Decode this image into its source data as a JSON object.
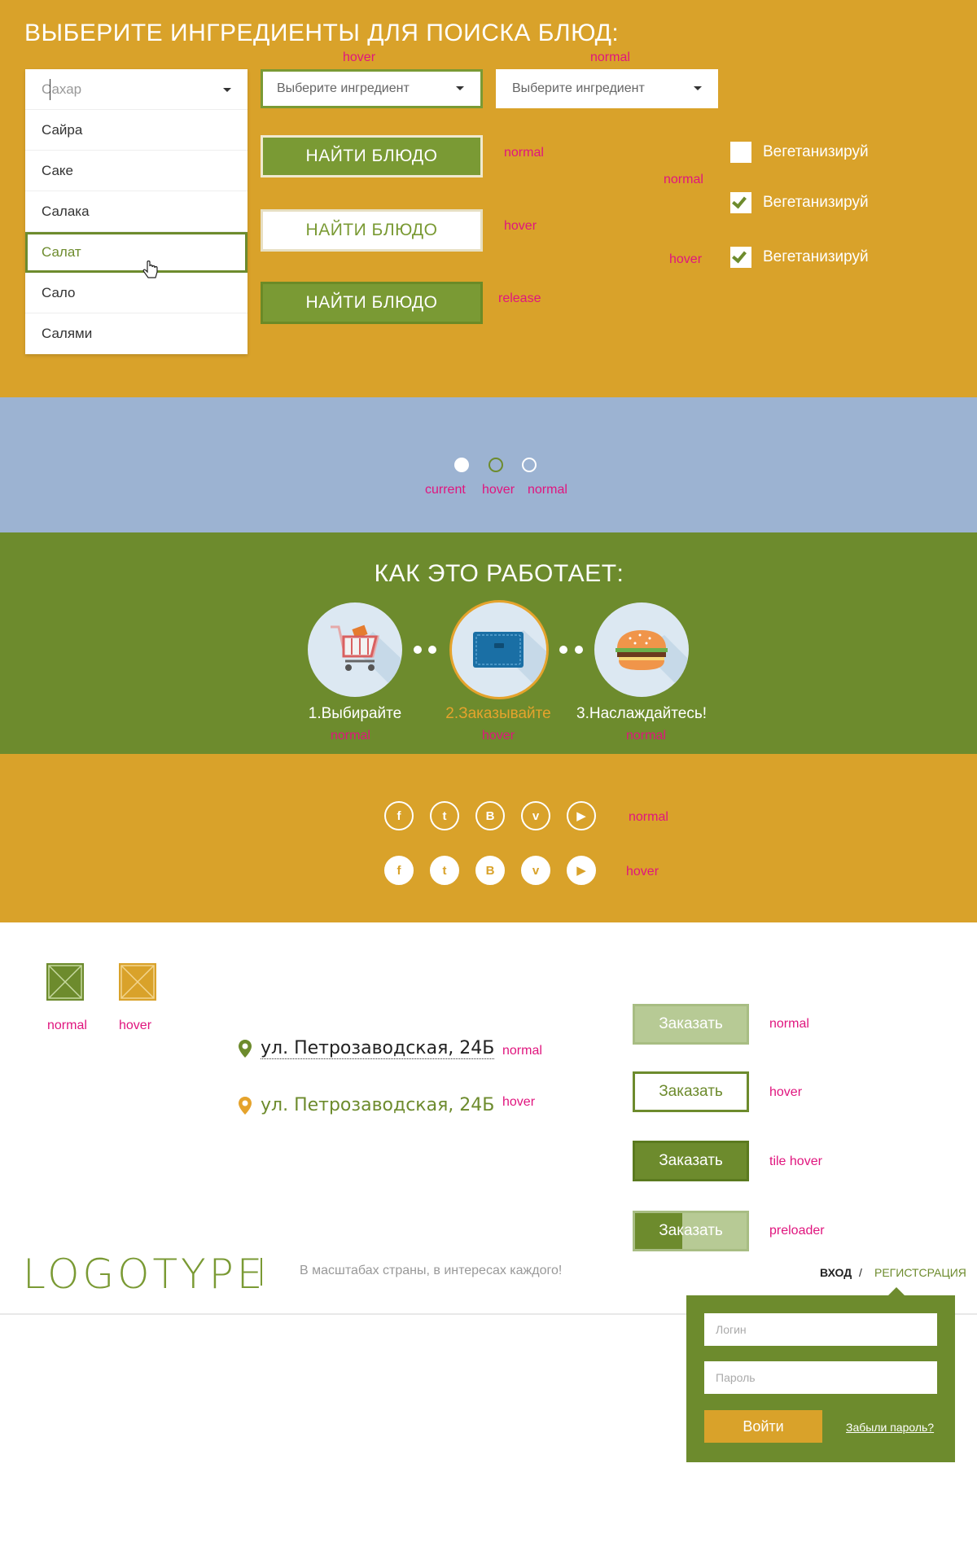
{
  "ingredients": {
    "heading": "ВЫБЕРИТЕ ИНГРЕДИЕНТЫ ДЛЯ ПОИСКА БЛЮД:",
    "search_value": "Сахар",
    "dropdown_items": [
      "Сайра",
      "Саке",
      "Салака",
      "Салат",
      "Сало",
      "Салями"
    ],
    "active_item_index": 3,
    "select_placeholder": "Выберите ингредиент",
    "find_button_label": "НАЙТИ БЛЮДО",
    "checkbox_label": "Вегетанизируй"
  },
  "notes": {
    "hover": "hover",
    "normal": "normal",
    "release": "release",
    "current": "current",
    "tile_hover": "tile hover",
    "preloader": "preloader"
  },
  "how_it_works": {
    "heading": "КАК ЭТО РАБОТАЕТ:",
    "steps": [
      {
        "label": "1.Выбирайте",
        "icon": "cart-icon"
      },
      {
        "label": "2.Заказывайте",
        "icon": "wallet-icon"
      },
      {
        "label": "3.Наслаждайтесь!",
        "icon": "burger-icon"
      }
    ]
  },
  "social": {
    "icons": [
      "facebook-icon",
      "twitter-icon",
      "vk-icon",
      "vimeo-icon",
      "youtube-icon"
    ],
    "glyphs": [
      "f",
      "t",
      "B",
      "v",
      "▶"
    ]
  },
  "address": {
    "text": "ул. Петрозаводская, 24Б"
  },
  "order": {
    "button_label": "Заказать",
    "preloader_progress": 0.42
  },
  "header": {
    "logo": "LOGOTYPE",
    "tagline": "В масштабах страны, в интересах каждого!",
    "login_link": "ВХОД",
    "separator": "/",
    "register_link": "РЕГИСТСРАЦИЯ"
  },
  "login_form": {
    "login_placeholder": "Логин",
    "password_placeholder": "Пароль",
    "submit_label": "Войти",
    "forgot_link": "Забыли пароль?"
  },
  "colors": {
    "green": "#6d8b2d",
    "yellow": "#d9a22a",
    "blue": "#9cb3d2",
    "note_pink": "#e0157e"
  }
}
